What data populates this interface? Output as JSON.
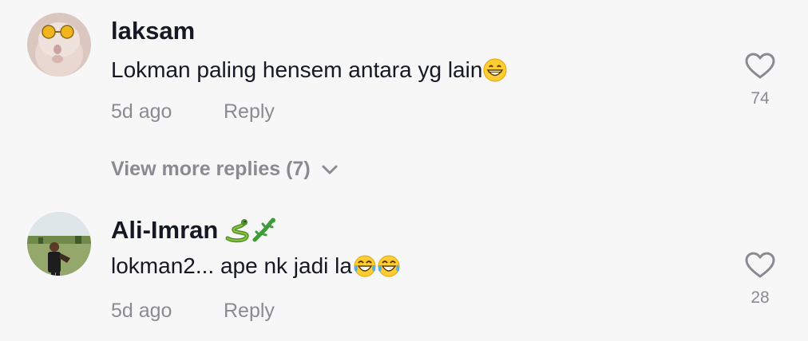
{
  "comments": [
    {
      "username": "laksam",
      "user_emojis": [],
      "text": "Lokman paling hensem antara yg lain",
      "text_emojis": [
        "grinning-face-with-smiling-eyes"
      ],
      "time": "5d ago",
      "reply_label": "Reply",
      "like_count": "74"
    },
    {
      "username": "Ali-Imran",
      "user_emojis": [
        "snake",
        "lizard"
      ],
      "text": "lokman2... ape nk jadi la",
      "text_emojis": [
        "face-with-tears-of-joy",
        "face-with-tears-of-joy"
      ],
      "time": "5d ago",
      "reply_label": "Reply",
      "like_count": "28"
    }
  ],
  "view_more_replies": "View more replies (7)",
  "colors": {
    "background": "#f7f7f7",
    "primary_text": "#161823",
    "secondary_text": "#8a8b91",
    "icon_gray": "#8a8b91"
  },
  "icons": {
    "like": "heart-outline-icon",
    "expand": "chevron-down-icon"
  }
}
